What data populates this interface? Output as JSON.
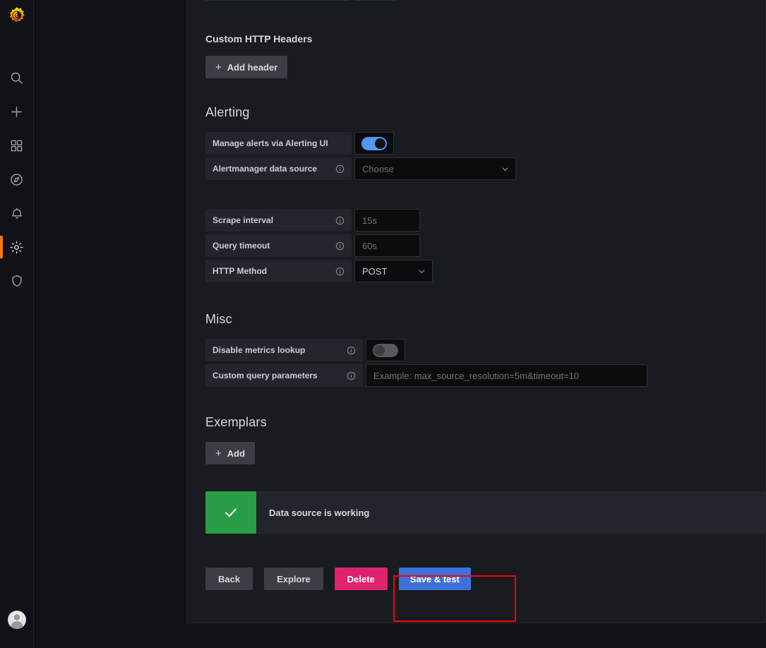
{
  "sidebar": {
    "logo": "grafana-logo",
    "items": [
      {
        "icon": "search-icon",
        "name": "search"
      },
      {
        "icon": "plus-icon",
        "name": "create"
      },
      {
        "icon": "dashboards-icon",
        "name": "dashboards"
      },
      {
        "icon": "compass-icon",
        "name": "explore"
      },
      {
        "icon": "bell-icon",
        "name": "alerting"
      },
      {
        "icon": "gear-icon",
        "name": "configuration",
        "active": true
      },
      {
        "icon": "shield-icon",
        "name": "server-admin"
      }
    ],
    "avatar": "user-avatar"
  },
  "sections": {
    "custom_http_headers": {
      "title": "Custom HTTP Headers",
      "add_button": "Add header",
      "add_icon": "plus-icon"
    },
    "alerting": {
      "title": "Alerting",
      "manage_alerts": {
        "label": "Manage alerts via Alerting UI",
        "toggle_state": "on"
      },
      "alertmanager": {
        "label": "Alertmanager data source",
        "info_icon": "info-circle-icon",
        "select_value": "Choose",
        "chevron": "chevron-down-icon"
      }
    },
    "http_settings": {
      "scrape_interval": {
        "label": "Scrape interval",
        "info_icon": "info-circle-icon",
        "placeholder": "15s",
        "value": ""
      },
      "query_timeout": {
        "label": "Query timeout",
        "info_icon": "info-circle-icon",
        "placeholder": "60s",
        "value": ""
      },
      "http_method": {
        "label": "HTTP Method",
        "info_icon": "info-circle-icon",
        "select_value": "POST",
        "chevron": "chevron-down-icon"
      }
    },
    "misc": {
      "title": "Misc",
      "disable_metrics_lookup": {
        "label": "Disable metrics lookup",
        "info_icon": "info-circle-icon",
        "toggle_state": "off"
      },
      "custom_query_parameters": {
        "label": "Custom query parameters",
        "info_icon": "info-circle-icon",
        "placeholder": "Example: max_source_resolution=5m&timeout=10",
        "value": ""
      }
    },
    "exemplars": {
      "title": "Exemplars",
      "add_button": "Add",
      "add_icon": "plus-icon"
    }
  },
  "status_alert": {
    "icon": "check-icon",
    "message": "Data source is working",
    "color": "#299c46"
  },
  "footer_buttons": {
    "back": "Back",
    "explore": "Explore",
    "delete": "Delete",
    "save_and_test": "Save & test"
  },
  "annotation": {
    "type": "highlight-rectangle",
    "color": "#ff0000",
    "target": "save-and-test-button"
  },
  "colors": {
    "accent_blue": "#5794f2",
    "primary_button": "#3d71d9",
    "danger": "#e0226e",
    "success": "#299c46",
    "panel_bg": "#181b1f",
    "app_bg": "#111217",
    "brand_orange": "#ff780a"
  }
}
